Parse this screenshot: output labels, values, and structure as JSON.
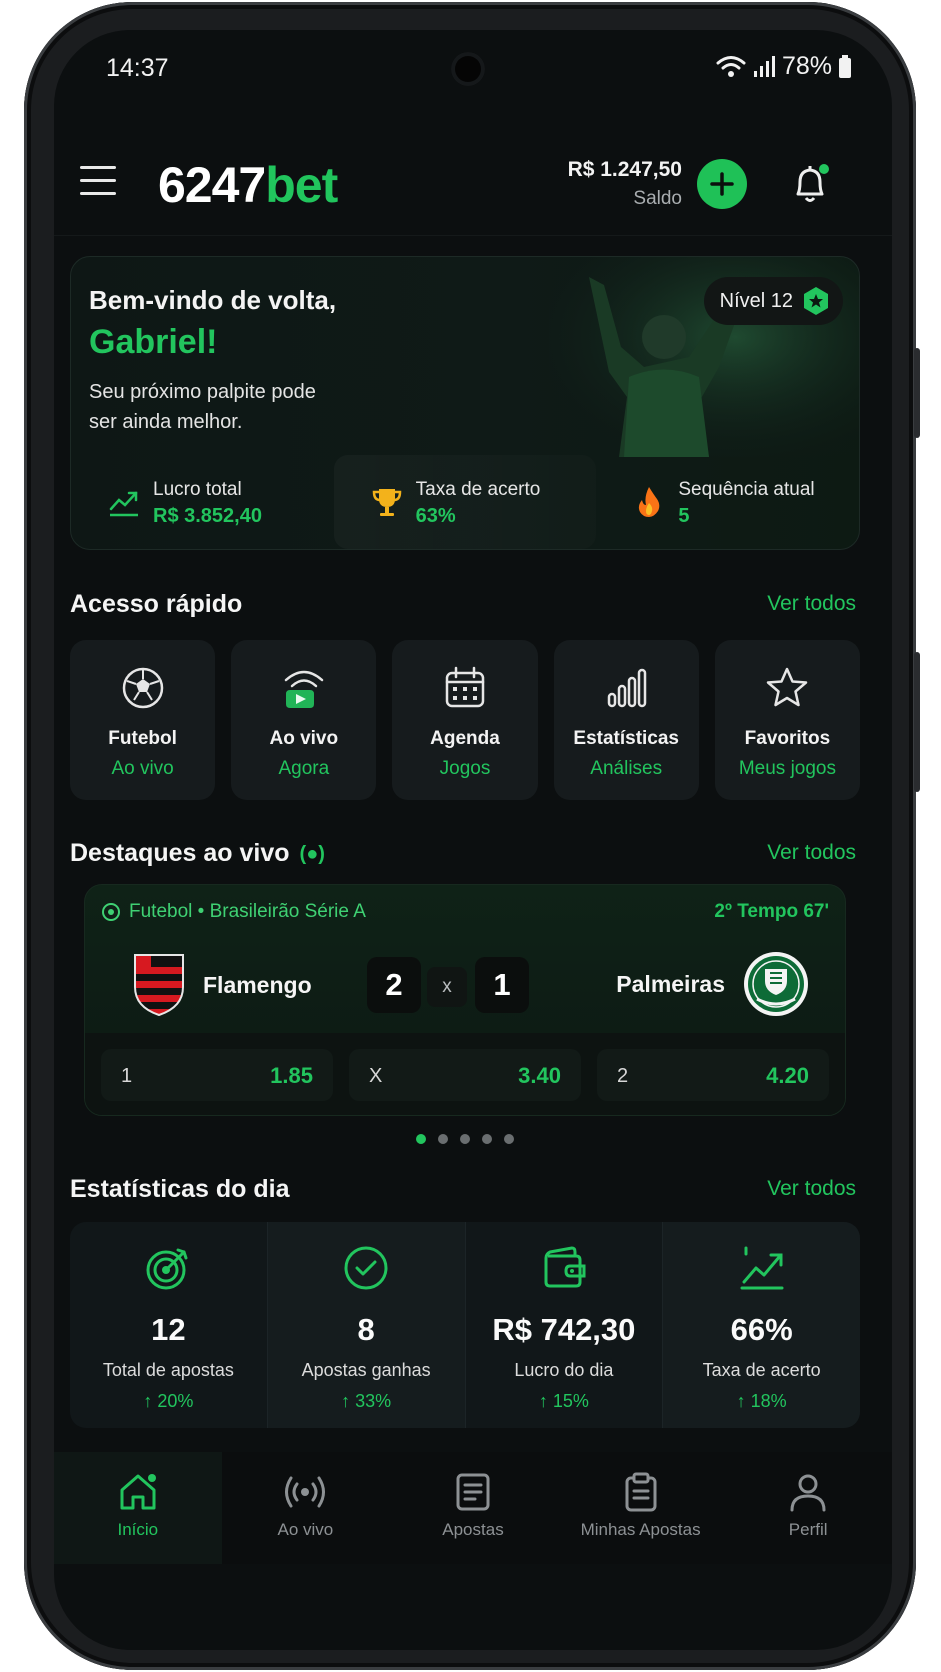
{
  "status": {
    "time": "14:37",
    "battery": "78%"
  },
  "header": {
    "logo_main": "6247",
    "logo_accent": "bet",
    "balance": "R$ 1.247,50",
    "balance_label": "Saldo"
  },
  "welcome": {
    "greeting": "Bem-vindo de volta,",
    "name": "Gabriel!",
    "message": "Seu próximo palpite pode ser ainda melhor.",
    "level": "Nível 12",
    "stats": [
      {
        "icon": "trend-up-icon",
        "title": "Lucro total",
        "value": "R$ 3.852,40"
      },
      {
        "icon": "trophy-icon",
        "title": "Taxa de acerto",
        "value": "63%"
      },
      {
        "icon": "fire-icon",
        "title": "Sequência atual",
        "value": "5"
      }
    ]
  },
  "quick_access": {
    "title": "Acesso rápido",
    "link": "Ver todos",
    "items": [
      {
        "icon": "soccer-ball-icon",
        "title": "Futebol",
        "subtitle": "Ao vivo"
      },
      {
        "icon": "live-broadcast-icon",
        "title": "Ao vivo",
        "subtitle": "Agora"
      },
      {
        "icon": "calendar-icon",
        "title": "Agenda",
        "subtitle": "Jogos"
      },
      {
        "icon": "bar-chart-icon",
        "title": "Estatísticas",
        "subtitle": "Análises"
      },
      {
        "icon": "star-icon",
        "title": "Favoritos",
        "subtitle": "Meus jogos"
      }
    ]
  },
  "live": {
    "title": "Destaques ao vivo",
    "live_marker": "(●)",
    "link": "Ver todos",
    "match": {
      "league": "Futebol • Brasileirão Série A",
      "period": "2º Tempo 67'",
      "home": "Flamengo",
      "away": "Palmeiras",
      "home_score": "2",
      "separator": "x",
      "away_score": "1",
      "odds": [
        {
          "label": "1",
          "value": "1.85"
        },
        {
          "label": "X",
          "value": "3.40"
        },
        {
          "label": "2",
          "value": "4.20"
        }
      ]
    },
    "carousel_active": 1,
    "carousel_count": 5
  },
  "day_stats": {
    "title": "Estatísticas do dia",
    "link": "Ver todos",
    "items": [
      {
        "icon": "target-icon",
        "value": "12",
        "label": "Total de apostas",
        "change": "↑ 20%"
      },
      {
        "icon": "check-circle-icon",
        "value": "8",
        "label": "Apostas ganhas",
        "change": "↑ 33%"
      },
      {
        "icon": "wallet-icon",
        "value": "R$ 742,30",
        "label": "Lucro do dia",
        "change": "↑ 15%"
      },
      {
        "icon": "trend-up-icon",
        "value": "66%",
        "label": "Taxa de acerto",
        "change": "↑ 18%"
      }
    ]
  },
  "nav": [
    {
      "icon": "home-icon",
      "label": "Início",
      "active": true
    },
    {
      "icon": "broadcast-icon",
      "label": "Ao vivo",
      "active": false
    },
    {
      "icon": "document-icon",
      "label": "Apostas",
      "active": false
    },
    {
      "icon": "clipboard-icon",
      "label": "Minhas Apostas",
      "active": false
    },
    {
      "icon": "user-icon",
      "label": "Perfil",
      "active": false
    }
  ],
  "colors": {
    "accent": "#22c55e",
    "background": "#0c0f10",
    "card": "#161b1d"
  }
}
